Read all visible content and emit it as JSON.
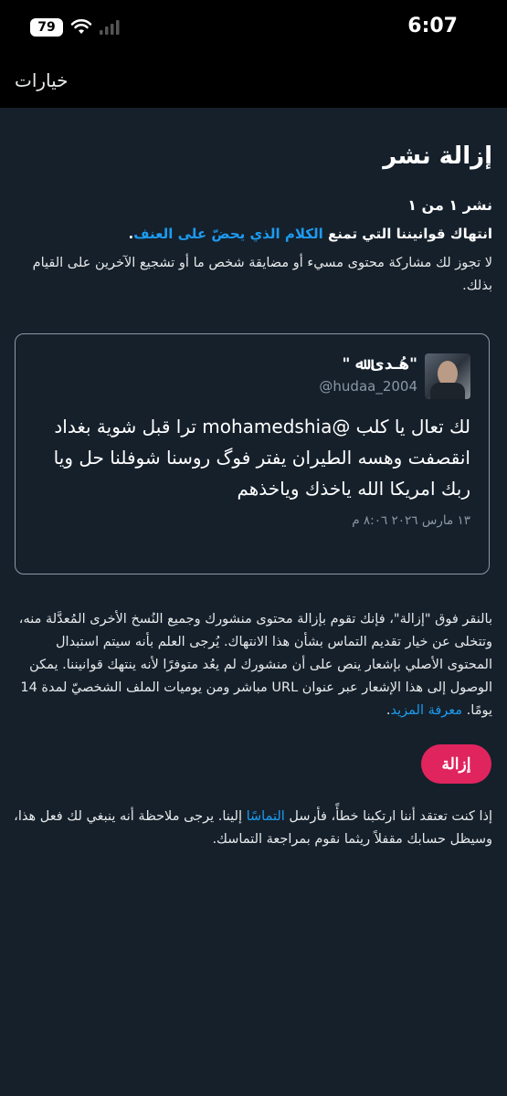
{
  "status_bar": {
    "battery": "79",
    "time": "6:07"
  },
  "header": {
    "title": "خيارات"
  },
  "page": {
    "title": "إزالة نشر",
    "post_count": "نشر ١ من ١",
    "violation_prefix": "انتهاك قوانيننا التي تمنع ",
    "violation_link": "الكلام الذي يحضّ على العنف",
    "violation_suffix": ".",
    "rule_description": "لا تجوز لك مشاركة محتوى مسيء أو مضايقة شخص ما أو تشجيع الآخرين على القيام بذلك."
  },
  "tweet": {
    "display_name": "\"هُـدى ﷲ \"",
    "handle": "@hudaa_2004",
    "text": "لك تعال يا كلب @mohamedshia ترا قبل شوية بغداد انقصفت وهسه الطيران يفتر فوگ روسنا شوفلنا حل ويا ربك امريكا الله ياخذك وياخذهم",
    "date": "١٣ مارس ٢٠٢٦ ٨:٠٦ م"
  },
  "removal": {
    "description": "بالنقر فوق \"إزالة\"، فإنك تقوم بإزالة محتوى منشورك وجميع النُسخ الأخرى المُعدَّلة منه، وتتخلى عن خيار تقديم التماس بشأن هذا الانتهاك. يُرجى العلم بأنه سيتم استبدال المحتوى الأصلي بإشعار ينص على أن منشورك لم يعُد متوفرًا لأنه ينتهك قوانيننا. يمكن الوصول إلى هذا الإشعار عبر عنوان URL مباشر ومن يوميات الملف الشخصيّ لمدة 14 يومًا. ",
    "learn_more": "معرفة المزيد",
    "learn_more_suffix": ".",
    "button_label": "إزالة"
  },
  "appeal": {
    "prefix": "إذا كنت تعتقد أننا ارتكبنا خطأً، فأرسل ",
    "link": "التماسًا",
    "suffix": " إلينا. يرجى ملاحظة أنه ينبغي لك فعل هذا، وسيظل حسابك مقفلاً ريثما نقوم بمراجعة التماسك."
  },
  "colors": {
    "background": "#15202b",
    "link": "#1d9bf0",
    "remove_button": "#e0245e"
  },
  "icons": [
    "wifi-icon",
    "cellular-signal-icon",
    "battery-icon"
  ]
}
